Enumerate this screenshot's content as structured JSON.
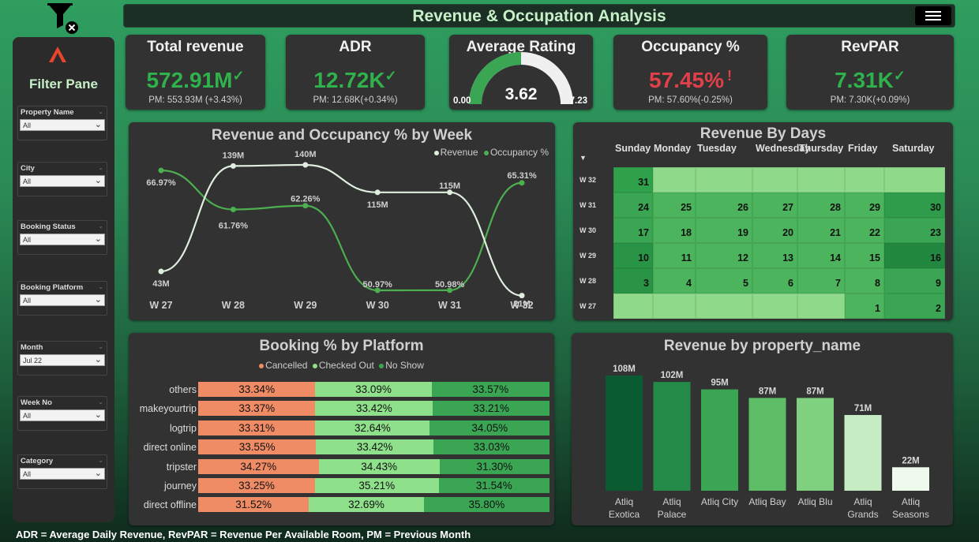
{
  "header": {
    "title": "Revenue & Occupation Analysis"
  },
  "icons": {
    "filter_clear": "filter-clear-icon",
    "menu": "hamburger-menu-icon",
    "logo": "atliq-logo-icon"
  },
  "filter_pane": {
    "title": "Filter Pane",
    "slicers": [
      {
        "label": "Property Name",
        "value": "All"
      },
      {
        "label": "City",
        "value": "All"
      },
      {
        "label": "Booking Status",
        "value": "All"
      },
      {
        "label": "Booking Platform",
        "value": "All"
      },
      {
        "label": "Month",
        "value": "Jul 22"
      },
      {
        "label": "Week No",
        "value": "All"
      },
      {
        "label": "Category",
        "value": "All"
      }
    ]
  },
  "kpis": {
    "total_revenue": {
      "title": "Total revenue",
      "value": "572.91M",
      "pm": "PM: 553.93M",
      "change": "(+3.43%)",
      "status": "up"
    },
    "adr": {
      "title": "ADR",
      "value": "12.72K",
      "pm": "PM: 12.68K",
      "change": "(+0.34%)",
      "status": "up"
    },
    "rating": {
      "title": "Average Rating",
      "value": "3.62",
      "min": "0.00",
      "max": "7.23",
      "fraction": 0.5
    },
    "occupancy": {
      "title": "Occupancy %",
      "value": "57.45%",
      "pm": "PM: 57.60%",
      "change": "(-0.25%)",
      "status": "down"
    },
    "revpar": {
      "title": "RevPAR",
      "value": "7.31K",
      "pm": "PM: 7.30K",
      "change": "(+0.09%)",
      "status": "up"
    }
  },
  "colors": {
    "good": "#2fb24c",
    "bad": "#e0404a",
    "cancelled": "#f08c65",
    "checked_out": "#8fe08a",
    "no_show": "#3aa653",
    "revenue_line": "#dfeede",
    "occupancy_line": "#4caf50"
  },
  "weekly": {
    "title": "Revenue and Occupancy % by Week",
    "legend": [
      "Revenue",
      "Occupancy %"
    ],
    "chart_data": {
      "type": "line",
      "categories": [
        "W 27",
        "W 28",
        "W 29",
        "W 30",
        "W 31",
        "W 32"
      ],
      "series": [
        {
          "name": "Revenue",
          "values": [
            43,
            139,
            140,
            115,
            115,
            21
          ],
          "labels": [
            "43M",
            "139M",
            "140M",
            "115M",
            "115M",
            "21M"
          ]
        },
        {
          "name": "Occupancy %",
          "values": [
            66.97,
            61.76,
            62.26,
            50.97,
            50.98,
            65.31
          ],
          "labels": [
            "66.97%",
            "61.76%",
            "62.26%",
            "50.97%",
            "50.98%",
            "65.31%"
          ]
        }
      ]
    }
  },
  "calendar": {
    "title": "Revenue By Days",
    "days": [
      "Sunday",
      "Monday",
      "Tuesday",
      "Wednesday",
      "Thursday",
      "Friday",
      "Saturday"
    ],
    "rows": [
      {
        "week": "W 32",
        "cells": [
          "31",
          "",
          "",
          "",
          "",
          "",
          ""
        ]
      },
      {
        "week": "W 31",
        "cells": [
          "24",
          "25",
          "26",
          "27",
          "28",
          "29",
          "30"
        ]
      },
      {
        "week": "W 30",
        "cells": [
          "17",
          "18",
          "19",
          "20",
          "21",
          "22",
          "23"
        ]
      },
      {
        "week": "W 29",
        "cells": [
          "10",
          "11",
          "12",
          "13",
          "14",
          "15",
          "16"
        ]
      },
      {
        "week": "W 28",
        "cells": [
          "3",
          "4",
          "5",
          "6",
          "7",
          "8",
          "9"
        ]
      },
      {
        "week": "W 27",
        "cells": [
          "",
          "",
          "",
          "",
          "",
          "1",
          "2"
        ]
      }
    ]
  },
  "platform": {
    "title": "Booking % by Platform",
    "legend": [
      "Cancelled",
      "Checked Out",
      "No Show"
    ],
    "chart_data": {
      "type": "bar",
      "stacked": true,
      "categories": [
        "others",
        "makeyourtrip",
        "logtrip",
        "direct online",
        "tripster",
        "journey",
        "direct offline"
      ],
      "series": [
        {
          "name": "Cancelled",
          "values": [
            33.34,
            33.37,
            33.31,
            33.55,
            34.27,
            33.25,
            31.52
          ]
        },
        {
          "name": "Checked Out",
          "values": [
            33.09,
            33.42,
            32.64,
            33.42,
            34.43,
            35.21,
            32.69
          ]
        },
        {
          "name": "No Show",
          "values": [
            33.57,
            33.21,
            34.05,
            33.03,
            31.3,
            31.54,
            35.8
          ]
        }
      ]
    }
  },
  "property": {
    "title": "Revenue by property_name",
    "chart_data": {
      "type": "bar",
      "categories": [
        "Atliq Exotica",
        "Atliq Palace",
        "Atliq City",
        "Atliq Bay",
        "Atliq Blu",
        "Atliq Grands",
        "Atliq Seasons"
      ],
      "values": [
        108,
        102,
        95,
        87,
        87,
        71,
        22
      ],
      "labels": [
        "108M",
        "102M",
        "95M",
        "87M",
        "87M",
        "71M",
        "22M"
      ],
      "colors": [
        "#0a5b31",
        "#238a47",
        "#3aa653",
        "#5ebd67",
        "#7fd07f",
        "#c6ecc3",
        "#eefaec"
      ]
    }
  },
  "footer": {
    "note": "ADR = Average Daily Revenue,  RevPAR = Revenue Per Available Room, PM = Previous Month"
  }
}
